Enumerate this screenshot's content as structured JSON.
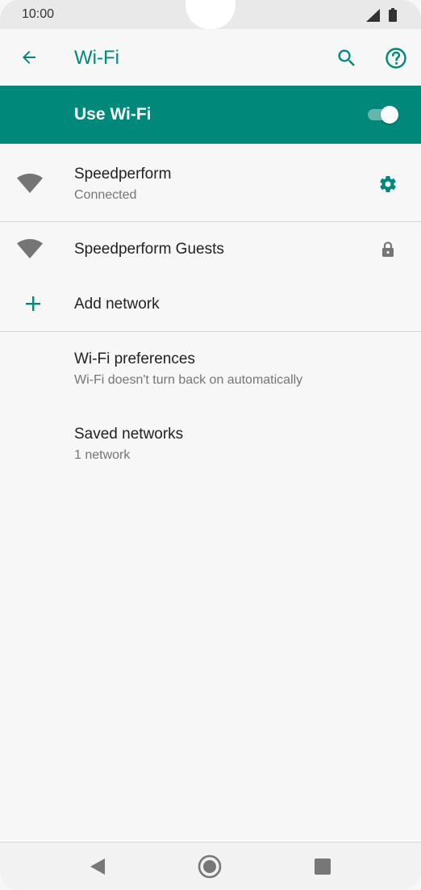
{
  "status": {
    "time": "10:00"
  },
  "header": {
    "title": "Wi-Fi"
  },
  "use_wifi": {
    "label": "Use Wi-Fi",
    "enabled": true
  },
  "networks": [
    {
      "name": "Speedperform",
      "status": "Connected",
      "action_icon": "gear-icon"
    },
    {
      "name": "Speedperform Guests",
      "status": "",
      "action_icon": "lock-icon"
    }
  ],
  "add_network": {
    "label": "Add network"
  },
  "preferences": {
    "title": "Wi-Fi preferences",
    "subtitle": "Wi-Fi doesn't turn back on automatically"
  },
  "saved": {
    "title": "Saved networks",
    "subtitle": "1 network"
  },
  "colors": {
    "accent": "#00897b",
    "background": "#f7f7f7",
    "icon_gray": "#757575"
  }
}
